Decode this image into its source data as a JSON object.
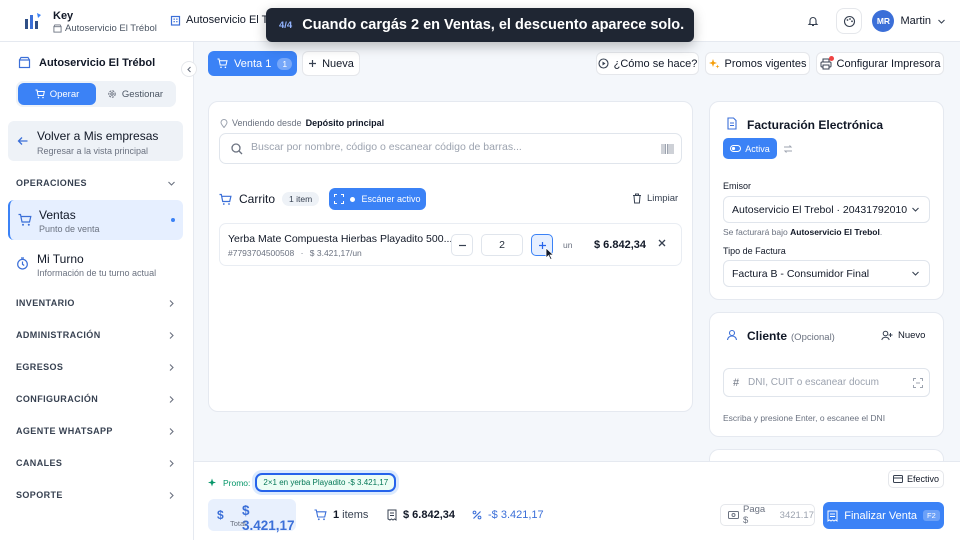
{
  "header": {
    "brand_title": "Key",
    "brand_sub": "Autoservicio El Trébol",
    "store": "Autoservicio El Trebol",
    "user_initials": "MR",
    "user_name": "Martin"
  },
  "tour": {
    "step": "4/4",
    "text": "Cuando cargás 2 en Ventas, el descuento aparece solo."
  },
  "sidebar": {
    "store": "Autoservicio El Trébol",
    "mode_operar": "Operar",
    "mode_gestionar": "Gestionar",
    "back_title": "Volver a Mis empresas",
    "back_sub": "Regresar a la vista principal",
    "section_operaciones": "OPERACIONES",
    "ventas_title": "Ventas",
    "ventas_sub": "Punto de venta",
    "turno_title": "Mi Turno",
    "turno_sub": "Información de tu turno actual",
    "sections": [
      "INVENTARIO",
      "ADMINISTRACIÓN",
      "EGRESOS",
      "CONFIGURACIÓN",
      "AGENTE WHATSAPP",
      "CANALES",
      "SOPORTE"
    ]
  },
  "toolbar": {
    "tab_label": "Venta 1",
    "tab_count": "1",
    "new_label": "Nueva",
    "help_label": "¿Cómo se hace?",
    "promos_label": "Promos vigentes",
    "printer_label": "Configurar Impresora"
  },
  "cart": {
    "from_label": "Vendiendo desde",
    "from_value": "Depósito principal",
    "search_placeholder": "Buscar por nombre, código o escanear código de barras...",
    "title": "Carrito",
    "items_badge": "1 item",
    "scanner_label": "Escáner activo",
    "clear_label": "Limpiar",
    "item": {
      "name": "Yerba Mate Compuesta Hierbas Playadito 500...",
      "code": "#7793704500508",
      "unit_price": "$ 3.421,17/un",
      "qty": "2",
      "unit": "un",
      "total": "$ 6.842,34"
    }
  },
  "billing": {
    "title": "Facturación Electrónica",
    "active_label": "Activa",
    "emisor_label": "Emisor",
    "emisor_value": "Autoservicio El Trebol · 20431792010",
    "emisor_note": "Se facturará bajo",
    "emisor_note_bold": "Autoservicio El Trebol",
    "tipo_label": "Tipo de Factura",
    "tipo_value": "Factura B - Consumidor Final"
  },
  "client": {
    "title": "Cliente",
    "optional": "(Opcional)",
    "new_label": "Nuevo",
    "dni_placeholder": "DNI, CUIT o escanear docum",
    "hint": "Escriba y presione Enter, o escanee el DNI"
  },
  "footer": {
    "promo_label": "Promo:",
    "promo_chip": "2×1 en yerba Playadito -$ 3.421,17",
    "payment_method": "Efectivo",
    "total_value": "$ 3.421,17",
    "total_label": "Total",
    "items_count": "1",
    "items_label": "items",
    "subtotal": "$ 6.842,34",
    "discount": "-$ 3.421,17",
    "pays_label": "Paga $",
    "pays_value": "3421.17",
    "finish_label": "Finalizar Venta",
    "finish_key": "F2"
  },
  "colors": {
    "accent": "#3b82f6",
    "promo_green": "#059669",
    "tour_bg": "#1f2633"
  }
}
